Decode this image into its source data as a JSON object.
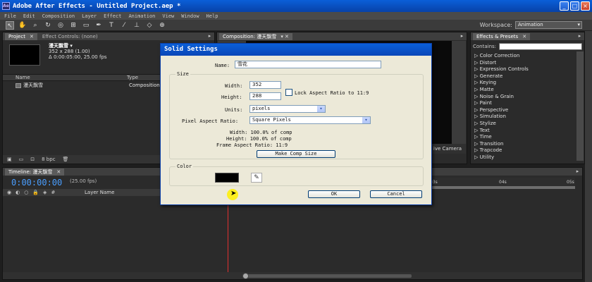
{
  "window": {
    "title": "Adobe After Effects - Untitled Project.aep *",
    "app_icon": "Ae"
  },
  "menu": [
    "File",
    "Edit",
    "Composition",
    "Layer",
    "Effect",
    "Animation",
    "View",
    "Window",
    "Help"
  ],
  "toolbar": {
    "workspace_label": "Workspace:",
    "workspace_value": "Animation"
  },
  "project_panel": {
    "tabs": [
      "Project",
      "Effect Controls: (none)"
    ],
    "item_name": "漫天飘雪 ▾",
    "item_dims": "352 x 288 (1.00)",
    "item_duration": "Δ 0:00:05:00, 25.00 fps",
    "columns": [
      "Name",
      "Type"
    ],
    "rows": [
      {
        "name": "漫天飘雪",
        "type": "Composition"
      }
    ],
    "footer_bpc": "8 bpc"
  },
  "comp_panel": {
    "tab": "Composition: 漫天飘雪",
    "live_camera": "ive Camera"
  },
  "effects_panel": {
    "tab": "Effects & Presets",
    "contains_label": "Contains:",
    "items": [
      "Color Correction",
      "Distort",
      "Expression Controls",
      "Generate",
      "Keying",
      "Matte",
      "Noise & Grain",
      "Paint",
      "Perspective",
      "Simulation",
      "Stylize",
      "Text",
      "Time",
      "Transition",
      "Trapcode",
      "Utility"
    ]
  },
  "timeline": {
    "tab": "Timeline: 漫天飘雪",
    "timecode": "0:00:00:00",
    "fps": "(25.00 fps)",
    "col_layer_name": "Layer Name",
    "ruler_labels": [
      "03s",
      "04s",
      "05s"
    ]
  },
  "dialog": {
    "title": "Solid Settings",
    "name_label": "Name:",
    "name_value": "雪花",
    "size_group": "Size",
    "width_label": "Width:",
    "width_value": "352",
    "height_label": "Height:",
    "height_value": "288",
    "lock_label": "Lock Aspect Ratio to 11:9",
    "units_label": "Units:",
    "units_value": "pixels",
    "par_label": "Pixel Aspect Ratio:",
    "par_value": "Square Pixels",
    "info_width": "Width:  100.0% of comp",
    "info_height": "Height:  100.0% of comp",
    "info_frame": "Frame Aspect Ratio: 11:9",
    "make_comp_size": "Make Comp Size",
    "color_group": "Color",
    "color_value": "#000000",
    "ok": "OK",
    "cancel": "Cancel"
  }
}
